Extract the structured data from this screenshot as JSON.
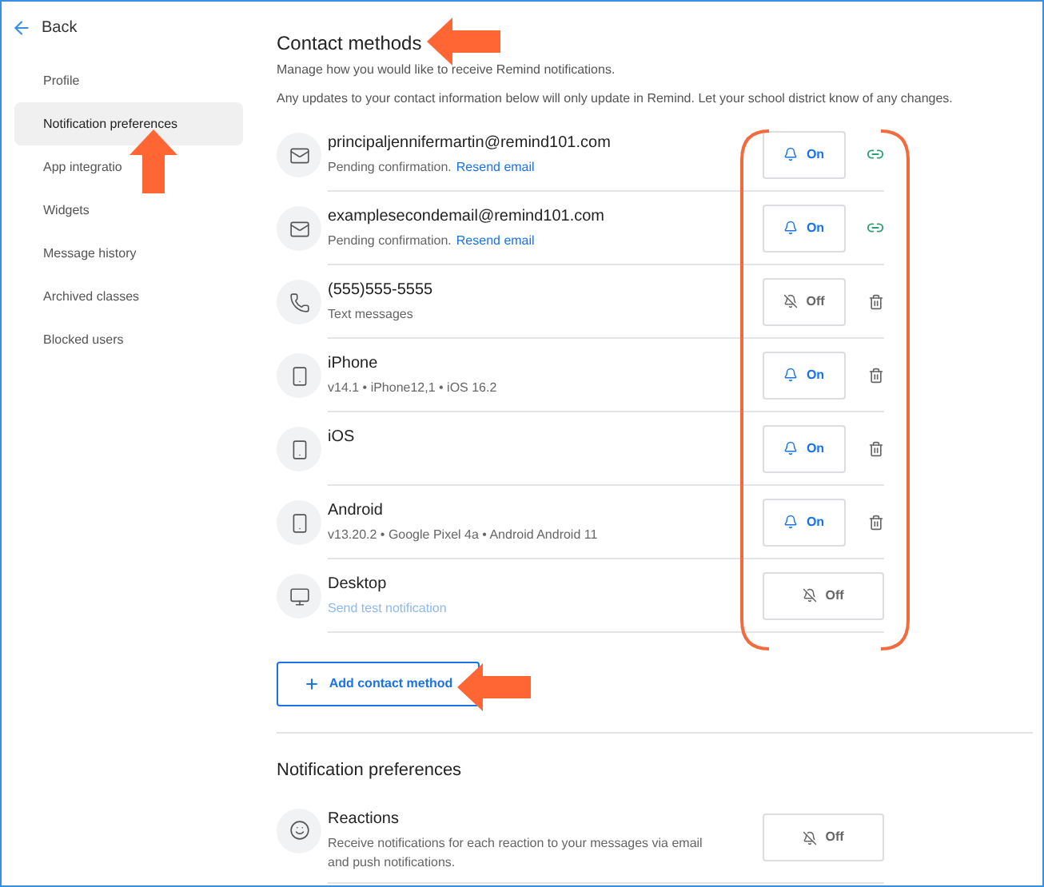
{
  "sidebar": {
    "back": "Back",
    "items": [
      {
        "label": "Profile",
        "selected": false
      },
      {
        "label": "Notification preferences",
        "selected": true
      },
      {
        "label": "App integratio",
        "selected": false
      },
      {
        "label": "Widgets",
        "selected": false
      },
      {
        "label": "Message history",
        "selected": false
      },
      {
        "label": "Archived classes",
        "selected": false
      },
      {
        "label": "Blocked users",
        "selected": false
      }
    ]
  },
  "contact_methods": {
    "title": "Contact methods",
    "descriptions": [
      "Manage how you would like to receive Remind notifications.",
      "Any updates to your contact information below will only update in Remind. Let your school district know of any changes."
    ],
    "items": [
      {
        "kind": "email",
        "name": "principaljennifermartin@remind101.com",
        "detail": "Pending confirmation.",
        "link": "Resend email",
        "toggle": {
          "label": "On",
          "on": true
        }
      },
      {
        "kind": "email",
        "name": "examplesecondemail@remind101.com",
        "detail": "Pending confirmation.",
        "link": "Resend email",
        "toggle": {
          "label": "On",
          "on": true
        }
      },
      {
        "kind": "phone",
        "name": "(555)555-5555",
        "detail": "Text messages",
        "toggle": {
          "label": "Off",
          "on": false
        }
      },
      {
        "kind": "device",
        "name": "iPhone",
        "detail": "v14.1 • iPhone12,1 • iOS 16.2",
        "toggle": {
          "label": "On",
          "on": true
        }
      },
      {
        "kind": "device",
        "name": "iOS",
        "toggle": {
          "label": "On",
          "on": true
        }
      },
      {
        "kind": "device",
        "name": "Android",
        "detail": "v13.20.2 • Google Pixel 4a • Android Android 11",
        "toggle": {
          "label": "On",
          "on": true
        }
      },
      {
        "kind": "desktop",
        "name": "Desktop",
        "link": "Send test notification",
        "toggle": {
          "label": "Off",
          "on": false
        }
      }
    ],
    "add_button": "Add contact method"
  },
  "notification_preferences": {
    "title": "Notification preferences",
    "items": [
      {
        "kind": "reaction",
        "name": "Reactions",
        "detail": "Receive notifications for each reaction to your messages via email and push notifications.",
        "toggle": {
          "label": "Off",
          "on": false
        }
      }
    ]
  }
}
